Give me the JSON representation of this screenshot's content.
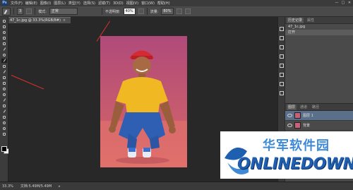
{
  "app": {
    "logo_text": "Ps",
    "menus": [
      "文件(F)",
      "编辑(E)",
      "图像(I)",
      "图层(L)",
      "类型(Y)",
      "选择(S)",
      "滤镜(T)",
      "3D(D)",
      "视图(V)",
      "窗口(W)",
      "帮助(H)"
    ],
    "window_controls": [
      "—",
      "□",
      "✕"
    ]
  },
  "options_bar": {
    "brush_size": "3",
    "mode_label": "模式:",
    "mode_value": "正常",
    "opacity_label": "不透明度:",
    "opacity_value": "40%",
    "flow_label": "流量:",
    "flow_value": "80%"
  },
  "document": {
    "tab_title": "47_1c.jpg @ 33.3%(RGB/8#)",
    "close_glyph": "×"
  },
  "status_bar": {
    "zoom": "33.3%",
    "doc_info": "文档:5.49M/5.49M",
    "arrow": "▸"
  },
  "panels": {
    "top_tabs": [
      "历史记录",
      "属性"
    ],
    "history_rows": [
      "47_1c.jpg",
      "打开"
    ],
    "mid_tabs": [
      "图层",
      "通道",
      "路径"
    ],
    "layers_labels": [
      "图层 1",
      "背景"
    ]
  },
  "icons": {
    "eye": "eye-icon",
    "brush": "brush-icon",
    "pressure": "pressure-icon",
    "airbrush": "airbrush-icon",
    "photo": "photo-image"
  },
  "colors": {
    "annotation": "#e03030",
    "watermark_blue": "#1f5fb0",
    "photo_bg": "#c55a6f"
  },
  "watermark": {
    "cn": "华军软件园",
    "en": "ONLINEDOWN.net"
  }
}
